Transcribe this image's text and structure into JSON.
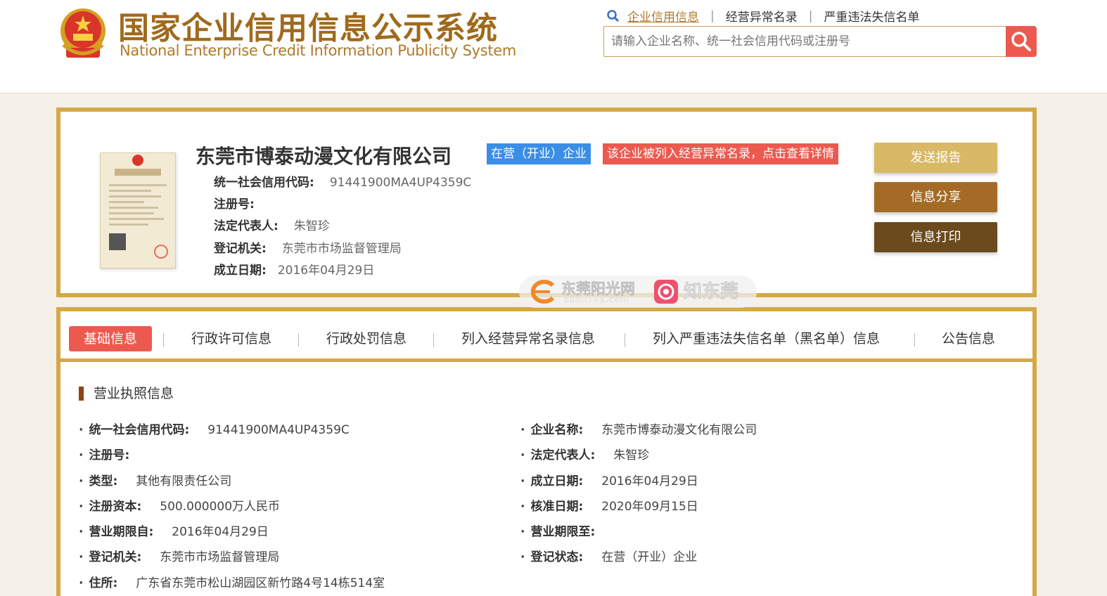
{
  "header": {
    "title_cn": "国家企业信用信息公示系统",
    "title_en": "National Enterprise Credit Information Publicity System",
    "links": [
      "企业信用信息",
      "经营异常名录",
      "严重违法失信名单"
    ],
    "search_placeholder": "请输入企业名称、统一社会信用代码或注册号"
  },
  "company": {
    "name": "东莞市博泰动漫文化有限公司",
    "status_tag": "在营（开业）企业",
    "alert_tag": "该企业被列入经营异常名录，点击查看详情",
    "rows": [
      {
        "k": "统一社会信用代码:",
        "v": "91441900MA4UP4359C"
      },
      {
        "k": "注册号:",
        "v": ""
      },
      {
        "k": "法定代表人:",
        "v": "朱智珍"
      },
      {
        "k": "登记机关:",
        "v": "东莞市市场监督管理局"
      },
      {
        "k": "成立日期:",
        "v": "2016年04月29日"
      }
    ],
    "buttons": [
      "发送报告",
      "信息分享",
      "信息打印"
    ]
  },
  "watermark": {
    "text1": "东莞阳光网",
    "text2": "sun0769.com",
    "text3": "知东莞"
  },
  "tabs": [
    "基础信息",
    "行政许可信息",
    "行政处罚信息",
    "列入经营异常名录信息",
    "列入严重违法失信名单（黑名单）信息",
    "公告信息"
  ],
  "section": {
    "title": "营业执照信息",
    "left": [
      {
        "k": "统一社会信用代码:",
        "v": "91441900MA4UP4359C"
      },
      {
        "k": "注册号:",
        "v": ""
      },
      {
        "k": "类型:",
        "v": "其他有限责任公司"
      },
      {
        "k": "注册资本:",
        "v": "500.000000万人民币"
      },
      {
        "k": "营业期限自:",
        "v": "2016年04月29日"
      },
      {
        "k": "登记机关:",
        "v": "东莞市市场监督管理局"
      },
      {
        "k": "住所:",
        "v": "广东省东莞市松山湖园区新竹路4号14栋514室"
      }
    ],
    "right": [
      {
        "k": "企业名称:",
        "v": "东莞市博泰动漫文化有限公司"
      },
      {
        "k": "法定代表人:",
        "v": "朱智珍"
      },
      {
        "k": "成立日期:",
        "v": "2016年04月29日"
      },
      {
        "k": "核准日期:",
        "v": "2020年09月15日"
      },
      {
        "k": "营业期限至:",
        "v": ""
      },
      {
        "k": "登记状态:",
        "v": "在营（开业）企业"
      }
    ]
  }
}
